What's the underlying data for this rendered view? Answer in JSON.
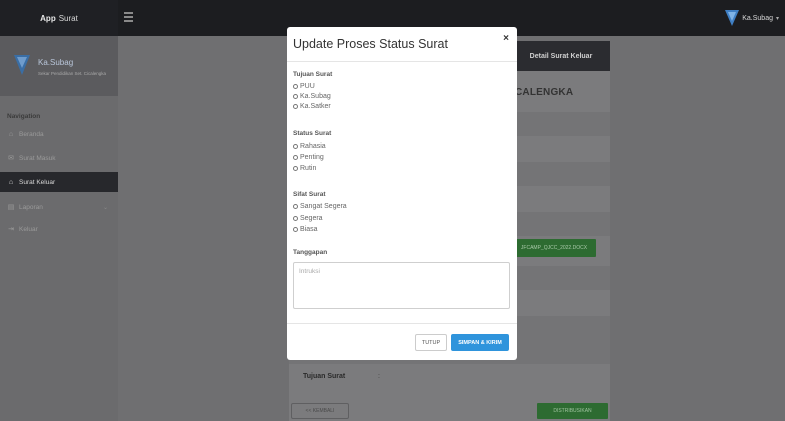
{
  "header": {
    "app_name_bold": "App",
    "app_name_rest": "Surat",
    "user_label": "Ka.Subag"
  },
  "sidebar": {
    "user_name": "Ka.Subag",
    "user_subtitle": "Sekar Pendidikan Set. Cicalengka",
    "nav_header": "Navigation",
    "items": [
      {
        "label": "Beranda",
        "icon": "home-icon"
      },
      {
        "label": "Surat Masuk",
        "icon": "mail-icon"
      },
      {
        "label": "Surat Keluar",
        "icon": "outbox-icon"
      },
      {
        "label": "Laporan",
        "icon": "report-icon"
      },
      {
        "label": "Keluar",
        "icon": "logout-icon"
      }
    ]
  },
  "background": {
    "panel_title": "Detail Surat Keluar",
    "heading_fragment": "CALENGKA",
    "file_button": "JFCAMP_QJCC_2022.DOCX",
    "row_label": "Tujuan Surat",
    "row_colon": ":",
    "back_button": "<< KEMBALI",
    "distribute_button": "DISTRIBUSIKAN"
  },
  "modal": {
    "title": "Update Proses Status Surat",
    "close_symbol": "×",
    "tujuan": {
      "label": "Tujuan Surat",
      "options": [
        "PUU",
        "Ka.Subag",
        "Ka.Satker"
      ]
    },
    "status": {
      "label": "Status Surat",
      "options": [
        "Rahasia",
        "Penting",
        "Rutin"
      ]
    },
    "sifat": {
      "label": "Sifat Surat",
      "options": [
        "Sangat Segera",
        "Segera",
        "Biasa"
      ]
    },
    "tanggapan": {
      "label": "Tanggapan",
      "placeholder": "Intruksi"
    },
    "close_button": "TUTUP",
    "save_button": "SIMPAN & KIRIM"
  },
  "colors": {
    "primary_button": "#2f94dc",
    "success_button": "#2d6b31",
    "topbar": "#1c1d20"
  }
}
